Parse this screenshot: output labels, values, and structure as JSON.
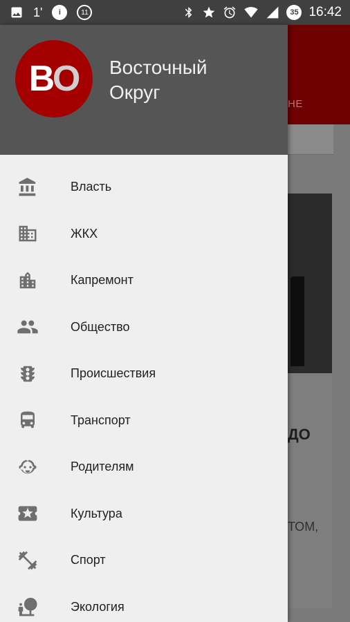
{
  "status_bar": {
    "signal_count": "1'",
    "badge_left": "11",
    "badge_right": "35",
    "time": "16:42"
  },
  "background": {
    "tab_text_fragment": "НЕ",
    "heading_fragment": "ДО",
    "body_fragment": "ТОМ,"
  },
  "drawer": {
    "logo_text": "ВО",
    "logo_letters": [
      "В",
      "О"
    ],
    "title_line1": "Восточный",
    "title_line2": "Округ",
    "items": [
      {
        "label": "Власть",
        "icon": "government-icon"
      },
      {
        "label": "ЖКХ",
        "icon": "building-icon"
      },
      {
        "label": "Капремонт",
        "icon": "city-icon"
      },
      {
        "label": "Общество",
        "icon": "people-icon"
      },
      {
        "label": "Происшествия",
        "icon": "traffic-light-icon"
      },
      {
        "label": "Транспорт",
        "icon": "bus-icon"
      },
      {
        "label": "Родителям",
        "icon": "child-face-icon"
      },
      {
        "label": "Культура",
        "icon": "ticket-star-icon"
      },
      {
        "label": "Спорт",
        "icon": "fitness-icon"
      },
      {
        "label": "Экология",
        "icon": "nature-people-icon"
      }
    ]
  },
  "colors": {
    "brand_red": "#a50000",
    "header_gray": "#555555",
    "drawer_bg": "#efefef",
    "icon_gray": "#6f6f6f"
  }
}
